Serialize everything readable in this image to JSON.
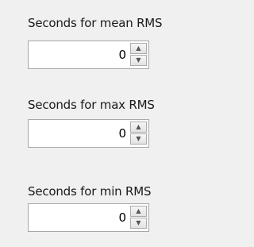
{
  "fields": [
    {
      "label": "Seconds for mean RMS",
      "value": "0"
    },
    {
      "label": "Seconds for max RMS",
      "value": "0"
    },
    {
      "label": "Seconds for min RMS",
      "value": "0"
    }
  ],
  "icons": {
    "increment": "▲",
    "decrement": "▼"
  }
}
